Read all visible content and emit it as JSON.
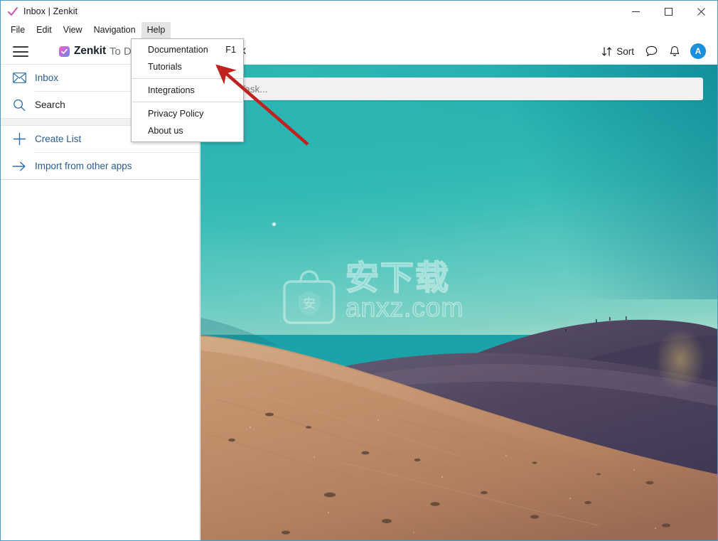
{
  "window": {
    "title": "Inbox | Zenkit",
    "icon": "checkmark-icon",
    "controls": {
      "minimize": "minimize-icon",
      "maximize": "maximize-icon",
      "close": "close-icon"
    }
  },
  "menubar": {
    "items": [
      {
        "label": "File",
        "active": false
      },
      {
        "label": "Edit",
        "active": false
      },
      {
        "label": "View",
        "active": false
      },
      {
        "label": "Navigation",
        "active": false
      },
      {
        "label": "Help",
        "active": true
      }
    ]
  },
  "help_menu": {
    "open": true,
    "groups": [
      {
        "items": [
          {
            "label": "Documentation",
            "accel": "F1"
          },
          {
            "label": "Tutorials",
            "accel": ""
          }
        ]
      },
      {
        "items": [
          {
            "label": "Integrations",
            "accel": ""
          }
        ]
      },
      {
        "items": [
          {
            "label": "Privacy Policy",
            "accel": ""
          },
          {
            "label": "About us",
            "accel": ""
          }
        ]
      }
    ]
  },
  "sidebar": {
    "hamburger": "hamburger-icon",
    "brand": {
      "logo": "zenkit-logo-icon",
      "name": "Zenkit",
      "suffix": "To Do"
    },
    "items": [
      {
        "label": "Inbox",
        "icon": "envelope-icon",
        "style": "link"
      },
      {
        "label": "Search",
        "icon": "search-icon",
        "style": "dark"
      },
      {
        "label": "Create List",
        "icon": "plus-icon",
        "style": "link"
      },
      {
        "label": "Import from other apps",
        "icon": "arrow-right-icon",
        "style": "link"
      }
    ]
  },
  "main": {
    "page_title": "Inbox",
    "tools": {
      "sort_label": "Sort",
      "sort_icon": "sort-arrows-icon",
      "comment_icon": "chat-bubble-icon",
      "notification_icon": "bell-icon",
      "avatar_initial": "A"
    },
    "add_task_placeholder": "Add Task..."
  },
  "watermark": {
    "bag_icon": "shopping-bag-icon",
    "bag_glyph": "安",
    "cn_text": "安下载",
    "en_text": "anxz.com"
  },
  "annotation": {
    "arrow": "red-arrow-pointer"
  },
  "colors": {
    "accent_blue": "#2a5d8f",
    "avatar_blue": "#1a8fe0",
    "sky_teal": "#2fb6b4",
    "sand": "#c08f6a",
    "dune_shadow": "#5a4c66",
    "annotation_red": "#c0231f",
    "menu_highlight": "#e4e4e4",
    "window_border": "#4a9cc7"
  }
}
